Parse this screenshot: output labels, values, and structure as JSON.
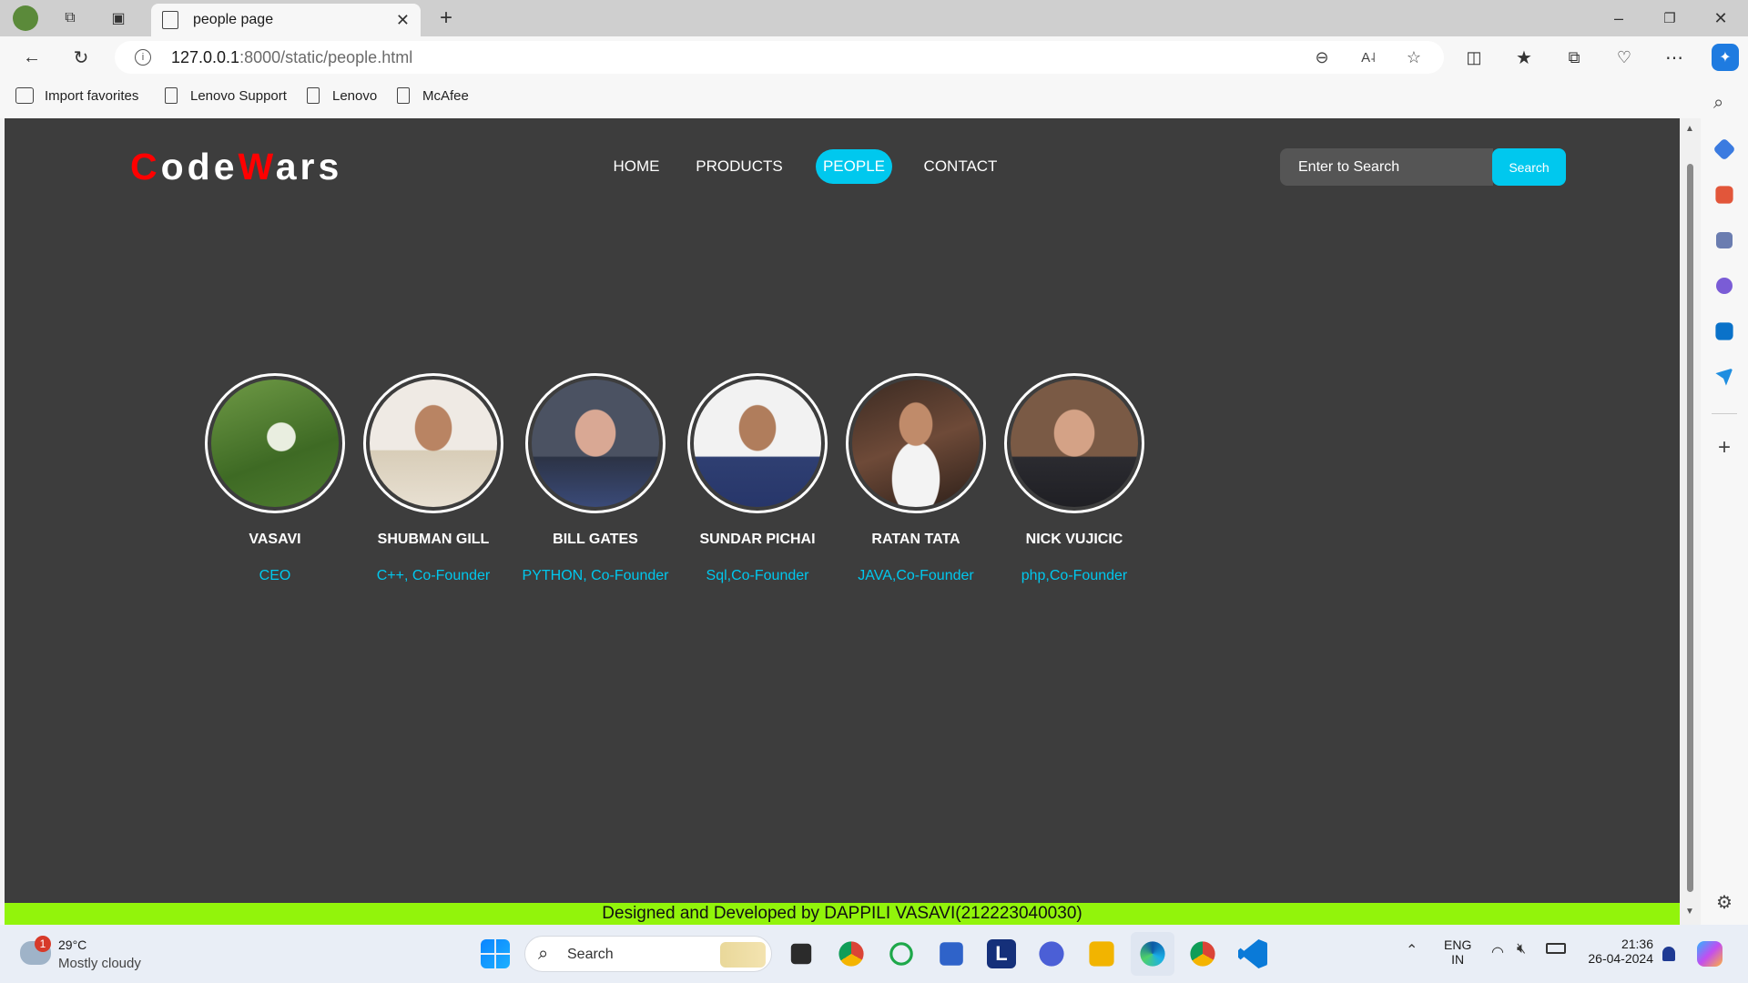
{
  "browser": {
    "tab_title": "people page",
    "url_host": "127.0.0.1",
    "url_path": ":8000/static/people.html",
    "favorites": [
      "Import favorites",
      "Lenovo Support",
      "Lenovo",
      "McAfee"
    ]
  },
  "site": {
    "logo": {
      "c": "C",
      "ode": "ode",
      "w": "W",
      "ars": "ars"
    },
    "nav": [
      "HOME",
      "PRODUCTS",
      "PEOPLE",
      "CONTACT"
    ],
    "active_nav": "PEOPLE",
    "search": {
      "placeholder": "Enter to Search",
      "button": "Search"
    },
    "people": [
      {
        "name": "VASAVI",
        "role": "CEO"
      },
      {
        "name": "SHUBMAN GILL",
        "role": "C++, Co-Founder"
      },
      {
        "name": "BILL GATES",
        "role": "PYTHON, Co-Founder"
      },
      {
        "name": "SUNDAR PICHAI",
        "role": "Sql,Co-Founder"
      },
      {
        "name": "RATAN TATA",
        "role": "JAVA,Co-Founder"
      },
      {
        "name": "NICK VUJICIC",
        "role": "php,Co-Founder"
      }
    ],
    "footer": "Designed and Developed by DAPPILI VASAVI(212223040030)"
  },
  "taskbar": {
    "weather_temp": "29°C",
    "weather_desc": "Mostly cloudy",
    "weather_badge": "1",
    "search_label": "Search",
    "lang": "ENG",
    "region": "IN",
    "time": "21:36",
    "date": "26-04-2024"
  },
  "colors": {
    "accent": "#00c8ee",
    "footer_bg": "#92f40b",
    "page_bg": "#3d3d3d",
    "logo_red": "#ff0000"
  }
}
